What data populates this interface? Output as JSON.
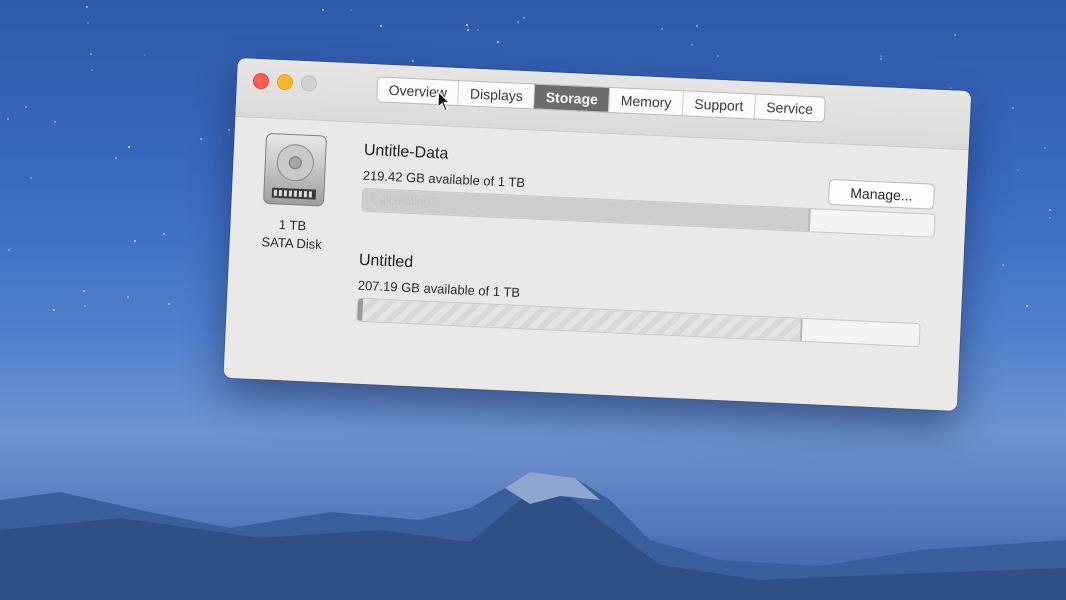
{
  "window": {
    "tabs": [
      {
        "label": "Overview"
      },
      {
        "label": "Displays"
      },
      {
        "label": "Storage"
      },
      {
        "label": "Memory"
      },
      {
        "label": "Support"
      },
      {
        "label": "Service"
      }
    ],
    "active_tab": "Storage"
  },
  "disk": {
    "size": "1 TB",
    "type": "SATA Disk"
  },
  "volumes": [
    {
      "name": "Untitle-Data",
      "available": "219.42 GB available of 1 TB",
      "status": "Calculating...",
      "used_fraction": 0.78
    },
    {
      "name": "Untitled",
      "available": "207.19 GB available of 1 TB",
      "used_fraction": 0.78
    }
  ],
  "buttons": {
    "manage": "Manage..."
  },
  "colors": {
    "close": "#fb5d55",
    "minimize": "#fdb52e",
    "active_tab": "#6d6c6b"
  }
}
